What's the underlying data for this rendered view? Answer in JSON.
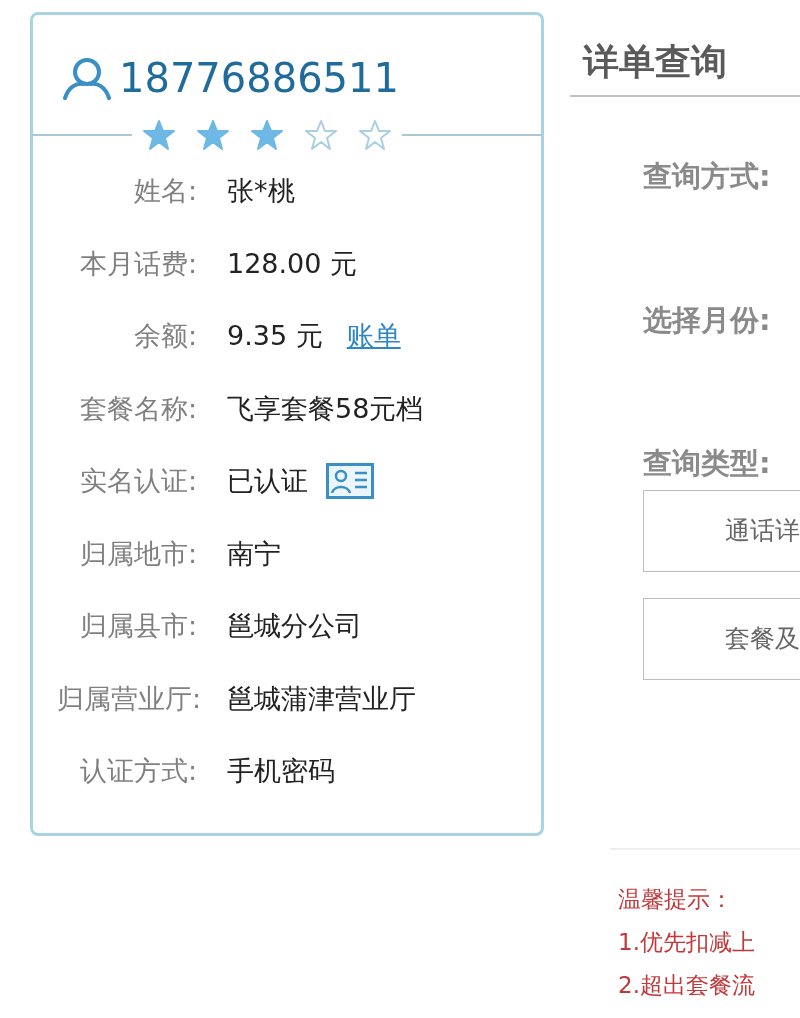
{
  "profile": {
    "phone": "18776886511",
    "stars": 3,
    "fields": [
      {
        "kind": "text",
        "label": "姓名:",
        "value": "张*桃"
      },
      {
        "kind": "text",
        "label": "本月话费:",
        "value": "128.00 元"
      },
      {
        "kind": "link",
        "label": "余额:",
        "value": "9.35 元",
        "link": "账单"
      },
      {
        "kind": "text",
        "label": "套餐名称:",
        "value": "飞享套餐58元档"
      },
      {
        "kind": "verified",
        "label": "实名认证:",
        "value": "已认证"
      },
      {
        "kind": "text",
        "label": "归属地市:",
        "value": "南宁"
      },
      {
        "kind": "text",
        "label": "归属县市:",
        "value": "邕城分公司"
      },
      {
        "kind": "text",
        "label": "归属营业厅:",
        "value": "邕城蒲津营业厅"
      },
      {
        "kind": "text",
        "label": "认证方式:",
        "value": "手机密码"
      }
    ]
  },
  "query": {
    "title": "详单查询",
    "labels": [
      "查询方式:",
      "选择月份:",
      "查询类型:"
    ],
    "type_buttons": [
      "通话详",
      "套餐及"
    ],
    "tips": {
      "title": "温馨提示：",
      "lines": [
        "1.优先扣减上",
        "2.超出套餐流"
      ]
    }
  }
}
